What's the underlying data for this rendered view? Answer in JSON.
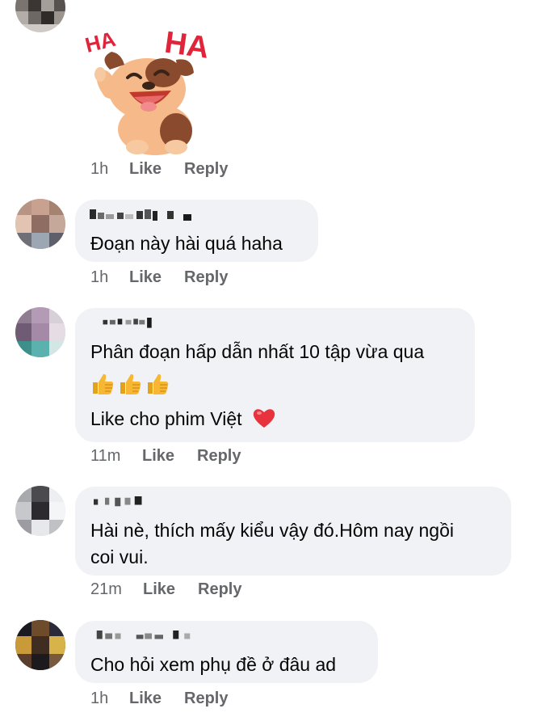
{
  "comments": [
    {
      "sticker": {
        "description": "laughing puppy sticker",
        "text_left": "HA",
        "text_right": "HA",
        "colors": {
          "text": "#e0243a",
          "fur": "#f5b98a",
          "patch": "#8a4a2e"
        }
      },
      "time": "1h",
      "like_label": "Like",
      "reply_label": "Reply"
    },
    {
      "lines": [
        "Đoạn này hài quá haha"
      ],
      "time": "1h",
      "like_label": "Like",
      "reply_label": "Reply"
    },
    {
      "lines": [
        "Phân đoạn hấp dẫn nhất 10 tập vừa qua",
        "Like cho phim Việt"
      ],
      "emoji_line": [
        "thumbs-up",
        "thumbs-up",
        "thumbs-up"
      ],
      "trailing_emoji": "red-heart",
      "time": "11m",
      "like_label": "Like",
      "reply_label": "Reply"
    },
    {
      "lines": [
        "Hài nè, thích mấy kiểu vậy đó.Hôm nay ngồi",
        "coi vui."
      ],
      "time": "21m",
      "like_label": "Like",
      "reply_label": "Reply"
    },
    {
      "lines": [
        "Cho hỏi xem phụ đề ở đâu ad"
      ],
      "time": "1h",
      "like_label": "Like",
      "reply_label": "Reply"
    }
  ],
  "colors": {
    "bubble": "#f0f2f5",
    "meta_text": "#65676b",
    "comment_text": "#050505",
    "heart": "#e8333f",
    "thumb": "#f7b733"
  }
}
